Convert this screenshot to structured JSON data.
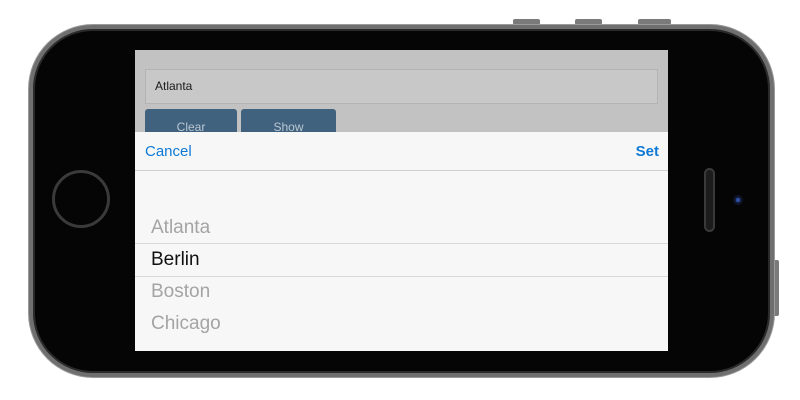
{
  "app": {
    "city_input_value": "Atlanta",
    "clear_label": "Clear",
    "show_label": "Show"
  },
  "picker": {
    "cancel_label": "Cancel",
    "set_label": "Set",
    "items": [
      "Atlanta",
      "Berlin",
      "Boston",
      "Chicago"
    ],
    "selected": "Berlin"
  },
  "colors": {
    "accent": "#0f7ad6",
    "app_button": "#41627e",
    "phone_body": "#050505"
  }
}
